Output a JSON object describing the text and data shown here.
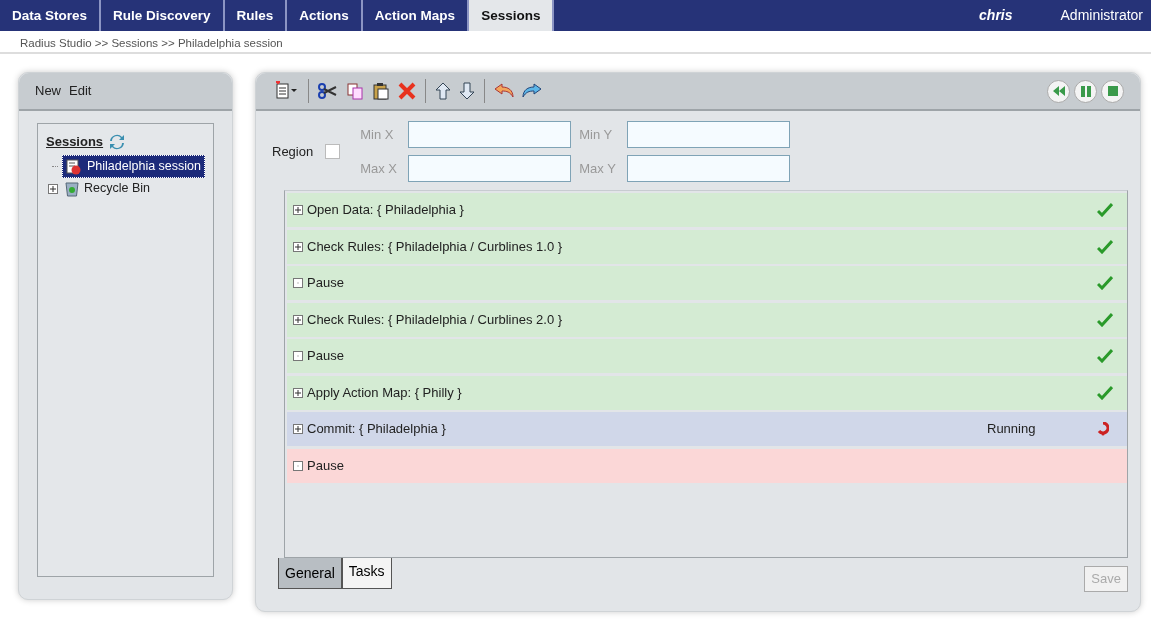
{
  "nav": {
    "tabs": [
      {
        "label": "Data Stores",
        "selected": false
      },
      {
        "label": "Rule Discovery",
        "selected": false
      },
      {
        "label": "Rules",
        "selected": false
      },
      {
        "label": "Actions",
        "selected": false
      },
      {
        "label": "Action Maps",
        "selected": false
      },
      {
        "label": "Sessions",
        "selected": true
      }
    ],
    "user": "chris",
    "role": "Administrator"
  },
  "breadcrumb": "Radius Studio >> Sessions >> Philadelphia session",
  "sidebar": {
    "menu": [
      "New",
      "Edit"
    ],
    "root": "Sessions",
    "items": [
      {
        "kind": "session",
        "label": "Philadelphia session",
        "selected": true
      },
      {
        "kind": "bin",
        "label": "Recycle Bin",
        "selected": false,
        "expanded": false
      }
    ]
  },
  "region": {
    "label": "Region",
    "checked": false,
    "fields": [
      {
        "label": "Min X"
      },
      {
        "label": "Min Y"
      },
      {
        "label": "Max X"
      },
      {
        "label": "Max Y"
      }
    ]
  },
  "tasks": [
    {
      "kind": "group",
      "label": "Open Data: { Philadelphia }",
      "done": true,
      "running": false
    },
    {
      "kind": "group",
      "label": "Check Rules: { Philadelphia / Curblines 1.0 }",
      "done": true,
      "running": false
    },
    {
      "kind": "leaf",
      "label": "Pause",
      "done": true,
      "running": false
    },
    {
      "kind": "group",
      "label": "Check Rules: { Philadelphia / Curblines 2.0 }",
      "done": true,
      "running": false
    },
    {
      "kind": "leaf",
      "label": "Pause",
      "done": true,
      "running": false
    },
    {
      "kind": "group",
      "label": "Apply Action Map: { Philly }",
      "done": true,
      "running": false
    },
    {
      "kind": "group",
      "label": "Commit: { Philadelphia }",
      "done": false,
      "running": true,
      "status": "Running"
    },
    {
      "kind": "leaf",
      "label": "Pause",
      "done": false,
      "running": false
    }
  ],
  "bottom_tabs": [
    {
      "label": "General",
      "selected": false
    },
    {
      "label": "Tasks",
      "selected": true
    }
  ],
  "save_button": {
    "label": "Save",
    "disabled": true
  }
}
